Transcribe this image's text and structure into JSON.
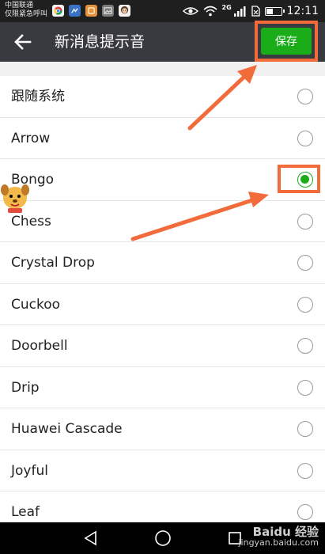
{
  "status_bar": {
    "carrier_line1": "中国联通",
    "carrier_line2": "仅限紧急呼叫",
    "network": "2G",
    "time": "12:11",
    "battery_level": 0.45
  },
  "header": {
    "title": "新消息提示音",
    "save_label": "保存",
    "accent_color": "#1aad19",
    "background_color": "#393a3f"
  },
  "sounds": {
    "items": [
      {
        "label": "跟随系统",
        "selected": false
      },
      {
        "label": "Arrow",
        "selected": false
      },
      {
        "label": "Bongo",
        "selected": true
      },
      {
        "label": "Chess",
        "selected": false
      },
      {
        "label": "Crystal Drop",
        "selected": false
      },
      {
        "label": "Cuckoo",
        "selected": false
      },
      {
        "label": "Doorbell",
        "selected": false
      },
      {
        "label": "Drip",
        "selected": false
      },
      {
        "label": "Huawei Cascade",
        "selected": false
      },
      {
        "label": "Joyful",
        "selected": false
      },
      {
        "label": "Leaf",
        "selected": false
      }
    ]
  },
  "annotation": {
    "highlight_color": "#f26b3a"
  },
  "watermark": {
    "brand": "Baidu 经验",
    "url": "jingyan.baidu.com"
  }
}
